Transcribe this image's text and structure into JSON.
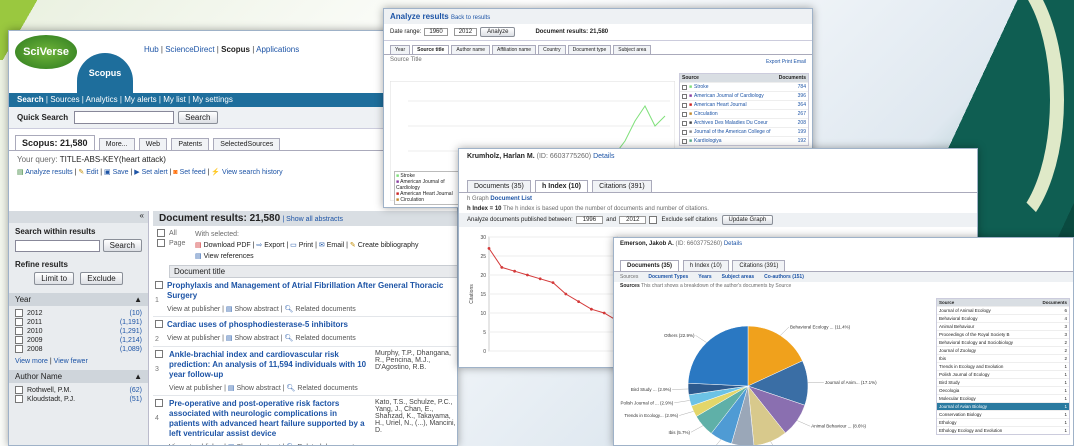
{
  "colors": {
    "nav_bar": "#1e6e9c",
    "accent_orange": "#ff6a00",
    "link": "#1d54a6",
    "brand_green": "#3a8a2a"
  },
  "main": {
    "logo_text": "SciVerse",
    "product": "Scopus",
    "top_links": [
      "Hub",
      "ScienceDirect",
      "Scopus",
      "Applications"
    ],
    "nav": [
      "Search",
      "Sources",
      "Analytics",
      "My alerts",
      "My list",
      "My settings"
    ],
    "quick_search_label": "Quick Search",
    "search_button": "Search",
    "tabs": [
      "Scopus: 21,580",
      "More...",
      "Web",
      "Patents",
      "SelectedSources"
    ],
    "query_label": "Your query:",
    "query": "TITLE-ABS-KEY(heart attack)",
    "actions": [
      "Analyze results",
      "Edit",
      "Save",
      "Set alert",
      "Set feed",
      "View search history"
    ],
    "search_within": "Search within results",
    "search_within_button": "Search",
    "refine": "Refine results",
    "limit_to": "Limit to",
    "exclude": "Exclude",
    "year_header": "Year",
    "years": [
      {
        "y": "2012",
        "c": "(10)"
      },
      {
        "y": "2011",
        "c": "(1,191)"
      },
      {
        "y": "2010",
        "c": "(1,291)"
      },
      {
        "y": "2009",
        "c": "(1,214)"
      },
      {
        "y": "2008",
        "c": "(1,089)"
      }
    ],
    "view_more": "View more",
    "view_fewer": "View fewer",
    "author_header": "Author Name",
    "authors": [
      {
        "n": "Rothwell, P.M.",
        "c": "(62)"
      },
      {
        "n": "Kloudstadt, P.J.",
        "c": "(51)"
      }
    ],
    "results_title": "Document results: 21,580",
    "show_abstracts": "Show all abstracts",
    "all": "All",
    "page": "Page",
    "with_selected": "With selected:",
    "tools": [
      "Download PDF",
      "Export",
      "Print",
      "Email",
      "Create bibliography",
      "View references"
    ],
    "col_title": "Document title",
    "docs": [
      {
        "num": "1",
        "title": "Prophylaxis and Management of Atrial Fibrillation After General Thoracic Surgery",
        "authors": ""
      },
      {
        "num": "2",
        "title": "Cardiac uses of phosphodiesterase-5 inhibitors",
        "authors": ""
      },
      {
        "num": "3",
        "title": "Ankle-brachial index and cardiovascular risk prediction: An analysis of 11,594 individuals with 10 year follow-up",
        "authors": "Murphy, T.P., Dhangana, R., Pencina, M.J., D'Agostino, R.B."
      },
      {
        "num": "4",
        "title": "Pre-operative and post-operative risk factors associated with neurologic complications in patients with advanced heart failure supported by a left ventricular assist device",
        "authors": "Kato, T.S., Schulze, P.C., Yang, J., Chan, E., Shahzad, K., Takayama, H., Uriel, N., (...), Mancini, D."
      }
    ],
    "view_publisher": "View at publisher",
    "show_abstract": "Show abstract",
    "related": "Related documents",
    "collapse": "«"
  },
  "analyze": {
    "title": "Analyze results",
    "back": "Back to results",
    "date_range": "Date range:",
    "from": "1960",
    "to": "2012",
    "analyze_btn": "Analyze",
    "doc_results": "Document results: 21,580",
    "tabs": [
      "Year",
      "Source title",
      "Author name",
      "Affiliation name",
      "Country",
      "Document type",
      "Subject area"
    ],
    "chart_caption": "Source Title",
    "table_head": [
      "Source",
      "Documents"
    ],
    "sources": [
      {
        "n": "Stroke",
        "c": "784"
      },
      {
        "n": "American Journal of Cardiology",
        "c": "396"
      },
      {
        "n": "American Heart Journal",
        "c": "364"
      },
      {
        "n": "Circulation",
        "c": "267"
      },
      {
        "n": "Archives Des Maladies Du Coeur",
        "c": "208"
      },
      {
        "n": "Journal of the American College of",
        "c": "199"
      },
      {
        "n": "Kardiologiya",
        "c": "192"
      }
    ],
    "legend": [
      "Stroke",
      "American Journal of Cardiology",
      "American Heart Journal",
      "Circulation"
    ],
    "export": "Export",
    "print": "Print",
    "email": "Email"
  },
  "hindex": {
    "author": "Krumholz, Harlan M.",
    "author_id": "(ID: 6603775260)",
    "details": "Details",
    "tabs": [
      "Documents (35)",
      "h Index (10)",
      "Citations (391)"
    ],
    "sub": [
      "h Graph",
      "Document List"
    ],
    "hlabel": "h Index = 10",
    "hdesc": "The h index is based upon the number of documents and number of citations.",
    "analyze_label": "Analyze documents published between:",
    "from": "1996",
    "and": "and",
    "to": "2012",
    "exclude": "Exclude self citations",
    "update": "Update Graph",
    "ylabel": "Citations"
  },
  "pie": {
    "author": "Emerson, Jakob A.",
    "author_id": "(ID: 6603775260)",
    "details": "Details",
    "tabs": [
      "Documents (35)",
      "h Index (10)",
      "Citations (391)"
    ],
    "sub": [
      "Sources",
      "Document Types",
      "Years",
      "Subject areas",
      "Co-authors (151)"
    ],
    "caption": "Sources",
    "caption_desc": "This chart shows a breakdown of the author's documents by Source",
    "table_head": [
      "Source",
      "Documents"
    ],
    "rows": [
      {
        "n": "Journal of Animal Ecology",
        "c": "6"
      },
      {
        "n": "Behavioral Ecology",
        "c": "4"
      },
      {
        "n": "Animal Behaviour",
        "c": "3"
      },
      {
        "n": "Proceedings of the Royal Society B",
        "c": "3"
      },
      {
        "n": "Behavioral Ecology and Sociobiology",
        "c": "2"
      },
      {
        "n": "Journal of Zoology",
        "c": "2"
      },
      {
        "n": "Ibis",
        "c": "2"
      },
      {
        "n": "Trends in Ecology and Evolution",
        "c": "1"
      },
      {
        "n": "Polish Journal of Ecology",
        "c": "1"
      },
      {
        "n": "Bird Study",
        "c": "1"
      },
      {
        "n": "Oecologia",
        "c": "1"
      },
      {
        "n": "Molecular Ecology",
        "c": "1"
      },
      {
        "n": "Journal of Avian Biology",
        "c": "1"
      },
      {
        "n": "Conservation Biology",
        "c": "1"
      },
      {
        "n": "Ethology",
        "c": "1"
      },
      {
        "n": "Ethology Ecology and Evolution",
        "c": "1"
      }
    ],
    "labels": [
      "Behavioral Ecology ... (11.4%)",
      "Journal of Anim... (17.1%)",
      "Proceedings of the ... (8.6%)",
      "Animal Behaviour ... (8.6%)",
      "Behavioral Ecology... (5.7%)",
      "Journal of Zoology... (5.7%)",
      "Ibis (5.7%)",
      "Others (22.9%)",
      "Trends in Ecology... (2.9%)",
      "Polish Journal of ... (2.9%)",
      "Bird Study ... (2.9%)"
    ]
  },
  "chart_data": [
    {
      "type": "line",
      "title": "h Index",
      "ylabel": "Citations",
      "ylim": [
        0,
        30
      ],
      "series": [
        {
          "values": [
            27,
            22,
            21,
            20,
            19,
            18,
            15,
            13,
            11,
            10,
            8
          ]
        }
      ]
    },
    {
      "type": "pie",
      "title": "Sources",
      "slices": [
        {
          "label": "Journal of Animal Ecology",
          "value": 17.1,
          "color": "#f0a11c"
        },
        {
          "label": "Behavioral Ecology",
          "value": 11.4,
          "color": "#3a6ea5"
        },
        {
          "label": "Animal Behaviour",
          "value": 8.6,
          "color": "#8a6fb0"
        },
        {
          "label": "Proceedings of the Royal Society B",
          "value": 8.6,
          "color": "#d8c98c"
        },
        {
          "label": "Behavioral Ecology and Sociobiology",
          "value": 5.7,
          "color": "#9aa7b8"
        },
        {
          "label": "Journal of Zoology",
          "value": 5.7,
          "color": "#4f9bd4"
        },
        {
          "label": "Ibis",
          "value": 5.7,
          "color": "#5fb0a8"
        },
        {
          "label": "Trends in Ecology and Evolution",
          "value": 2.9,
          "color": "#e3d66a"
        },
        {
          "label": "Polish Journal of Ecology",
          "value": 2.9,
          "color": "#6cc2e6"
        },
        {
          "label": "Bird Study",
          "value": 2.9,
          "color": "#2d5a8e"
        },
        {
          "label": "Others",
          "value": 22.9,
          "color": "#2a78c2"
        }
      ]
    }
  ]
}
